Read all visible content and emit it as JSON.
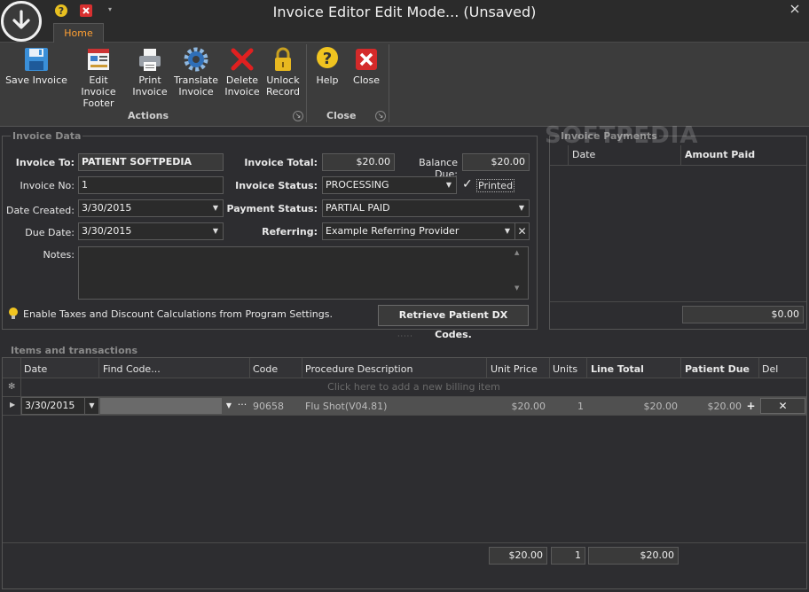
{
  "window": {
    "title": "Invoice Editor Edit Mode... (Unsaved)"
  },
  "ribbon": {
    "tab": "Home",
    "buttons": [
      {
        "label_line1": "Save Invoice",
        "label_line2": "",
        "icon": "save-icon"
      },
      {
        "label_line1": "Edit Invoice",
        "label_line2": "Footer",
        "icon": "edit-footer-icon"
      },
      {
        "label_line1": "Print",
        "label_line2": "Invoice",
        "icon": "printer-icon"
      },
      {
        "label_line1": "Translate",
        "label_line2": "Invoice",
        "icon": "gear-icon"
      },
      {
        "label_line1": "Delete",
        "label_line2": "Invoice",
        "icon": "delete-x-icon"
      },
      {
        "label_line1": "Unlock",
        "label_line2": "Record",
        "icon": "lock-icon"
      },
      {
        "label_line1": "Help",
        "label_line2": "",
        "icon": "help-icon"
      },
      {
        "label_line1": "Close",
        "label_line2": "",
        "icon": "close-icon"
      }
    ],
    "groups": {
      "actions": "Actions",
      "close": "Close"
    }
  },
  "invoice_data": {
    "section_title": "Invoice Data",
    "invoice_to_label": "Invoice To:",
    "invoice_to_value": "PATIENT SOFTPEDIA",
    "invoice_no_label": "Invoice No:",
    "invoice_no_value": "1",
    "date_created_label": "Date Created:",
    "date_created_value": "3/30/2015",
    "due_date_label": "Due Date:",
    "due_date_value": "3/30/2015",
    "notes_label": "Notes:",
    "notes_value": "",
    "invoice_total_label": "Invoice Total:",
    "invoice_total_value": "$20.00",
    "balance_due_label": "Balance Due:",
    "balance_due_value": "$20.00",
    "invoice_status_label": "Invoice Status:",
    "invoice_status_value": "PROCESSING",
    "printed_label": "Printed",
    "printed_checked": true,
    "payment_status_label": "Payment Status:",
    "payment_status_value": "PARTIAL PAID",
    "referring_label": "Referring:",
    "referring_value": "Example Referring Provider",
    "hint": "Enable Taxes and Discount Calculations from Program Settings.",
    "retrieve_button": "Retrieve Patient DX Codes."
  },
  "payments": {
    "section_title": "Invoice Payments",
    "watermark": "SOFTPEDIA",
    "columns": [
      "Date",
      "Amount Paid"
    ],
    "total": "$0.00"
  },
  "items": {
    "section_title": "Items and transactions",
    "columns": [
      "Date",
      "Find Code...",
      "Code",
      "Procedure Description",
      "Unit Price",
      "Units",
      "Line Total",
      "Patient Due",
      "Del"
    ],
    "new_row_hint": "Click here to add a new billing item",
    "rows": [
      {
        "date": "3/30/2015",
        "find_code": "",
        "code": "90658",
        "description": "Flu Shot(V04.81)",
        "unit_price": "$20.00",
        "units": "1",
        "line_total": "$20.00",
        "patient_due": "$20.00"
      }
    ],
    "footer": {
      "unit_price_total": "$20.00",
      "units_total": "1",
      "line_total": "$20.00"
    }
  }
}
